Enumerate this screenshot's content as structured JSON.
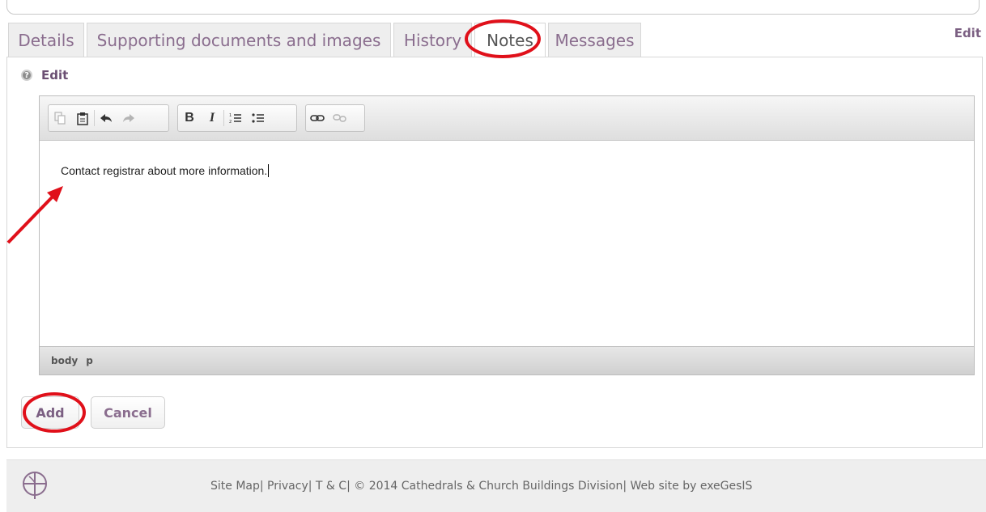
{
  "tabs": [
    {
      "label": "Details",
      "active": false
    },
    {
      "label": "Supporting documents and images",
      "active": false
    },
    {
      "label": "History",
      "active": false
    },
    {
      "label": "Notes",
      "active": true
    },
    {
      "label": "Messages",
      "active": false
    }
  ],
  "header": {
    "edit_link": "Edit"
  },
  "section": {
    "title": "Edit",
    "help_icon": "help-icon"
  },
  "editor": {
    "toolbar": {
      "group1": [
        "copy-icon",
        "paste-icon",
        "undo-icon",
        "redo-icon"
      ],
      "group2": [
        "bold",
        "italic",
        "numbered-list-icon",
        "bulleted-list-icon"
      ],
      "group3": [
        "link-icon",
        "unlink-icon"
      ],
      "bold_label": "B",
      "italic_label": "I"
    },
    "content": "Contact registrar about more information.",
    "statusbar": {
      "path1": "body",
      "path2": "p"
    }
  },
  "buttons": {
    "add": "Add",
    "cancel": "Cancel"
  },
  "footer": {
    "site_map": "Site Map",
    "privacy": "Privacy",
    "tc": "T & C",
    "copyright": "© 2014 Cathedrals & Church Buildings Division",
    "credit": "Web site by exeGesIS"
  },
  "colors": {
    "accent": "#7b5f82",
    "annotation": "#e0101a"
  }
}
